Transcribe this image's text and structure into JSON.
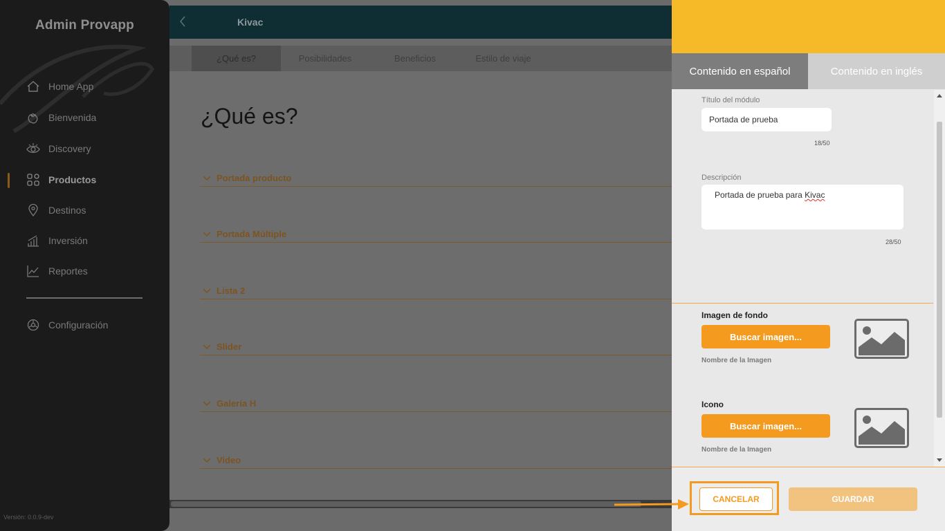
{
  "sidebar": {
    "title": "Admin Provapp",
    "items": [
      {
        "label": "Home App",
        "icon": "home-icon"
      },
      {
        "label": "Bienvenida",
        "icon": "wave-hand-icon"
      },
      {
        "label": "Discovery",
        "icon": "eye-icon"
      },
      {
        "label": "Productos",
        "icon": "grid-icon",
        "active": true
      },
      {
        "label": "Destinos",
        "icon": "map-pin-icon"
      },
      {
        "label": "Inversión",
        "icon": "bar-chart-icon"
      },
      {
        "label": "Reportes",
        "icon": "line-chart-icon"
      }
    ],
    "config": {
      "label": "Configuración",
      "icon": "gear-icon"
    },
    "version": "Versión: 0.0.9-dev"
  },
  "header": {
    "title": "Kivac",
    "back_icon": "chevron-left-icon"
  },
  "tabs": [
    {
      "label": "¿Qué es?",
      "active": true
    },
    {
      "label": "Posibilidades"
    },
    {
      "label": "Beneficios"
    },
    {
      "label": "Estilo de viaje"
    }
  ],
  "main": {
    "page_title": "¿Qué es?",
    "sections": [
      "Portada producto",
      "Portada Múltiple",
      "Lista 2",
      "Slider",
      "Galería H",
      "Video"
    ]
  },
  "panel": {
    "tab_es": "Contenido en español",
    "tab_en": "Contenido en inglés",
    "module_title_label": "Título del módulo",
    "module_title_value": "Portada de prueba",
    "module_title_counter": "18/50",
    "description_label": "Descripción",
    "description_value_prefix": "Portada de prueba para ",
    "description_value_word": "Kivac",
    "description_counter": "28/50",
    "background_image_title": "Imagen de fondo",
    "icon_title": "Icono",
    "search_image_button": "Buscar imagen...",
    "image_name_label": "Nombre de la Imagen",
    "cancel_button": "CANCELAR",
    "save_button": "GUARDAR"
  },
  "colors": {
    "accent": "#f39a1f",
    "panel_header": "#f6b928",
    "sidebar_bg": "#1b1b1b",
    "topbar_bg": "#0f2e33"
  }
}
